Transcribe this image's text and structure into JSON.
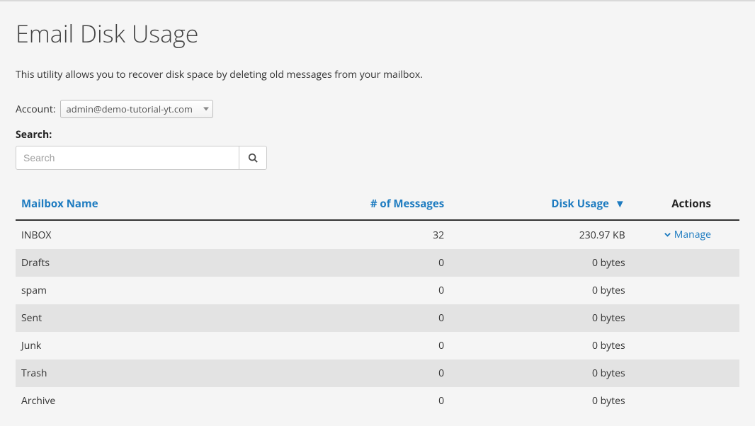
{
  "page": {
    "title": "Email Disk Usage",
    "description": "This utility allows you to recover disk space by deleting old messages from your mailbox."
  },
  "account": {
    "label": "Account:",
    "selected": "admin@demo-tutorial-yt.com"
  },
  "search": {
    "label": "Search:",
    "placeholder": "Search",
    "value": ""
  },
  "table": {
    "headers": {
      "name": "Mailbox Name",
      "messages": "# of Messages",
      "usage": "Disk Usage",
      "sort_indicator": "▼",
      "actions": "Actions"
    },
    "manage_label": "Manage",
    "rows": [
      {
        "name": "INBOX",
        "messages": "32",
        "usage": "230.97 KB",
        "manage": true
      },
      {
        "name": "Drafts",
        "messages": "0",
        "usage": "0 bytes",
        "manage": false
      },
      {
        "name": "spam",
        "messages": "0",
        "usage": "0 bytes",
        "manage": false
      },
      {
        "name": "Sent",
        "messages": "0",
        "usage": "0 bytes",
        "manage": false
      },
      {
        "name": "Junk",
        "messages": "0",
        "usage": "0 bytes",
        "manage": false
      },
      {
        "name": "Trash",
        "messages": "0",
        "usage": "0 bytes",
        "manage": false
      },
      {
        "name": "Archive",
        "messages": "0",
        "usage": "0 bytes",
        "manage": false
      }
    ]
  }
}
